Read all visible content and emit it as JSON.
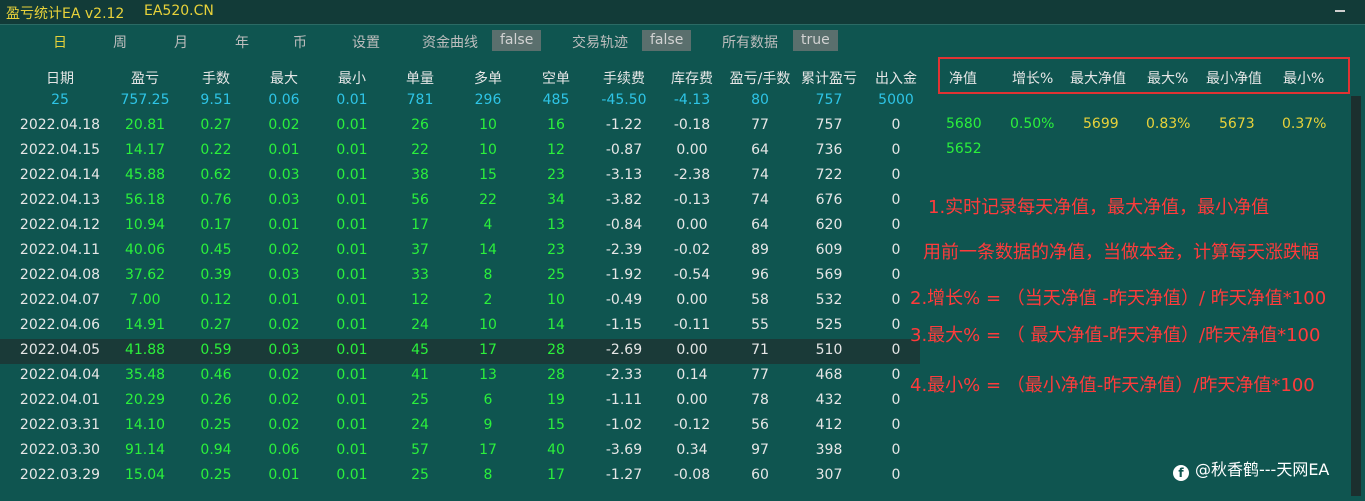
{
  "window": {
    "title": "盈亏统计EA v2.12",
    "site": "EA520.CN"
  },
  "tabs": [
    "日",
    "周",
    "月",
    "年",
    "币",
    "设置"
  ],
  "options": [
    {
      "label": "资金曲线",
      "value": "false"
    },
    {
      "label": "交易轨迹",
      "value": "false"
    },
    {
      "label": "所有数据",
      "value": "true"
    }
  ],
  "table": {
    "headers": [
      "日期",
      "盈亏",
      "手数",
      "最大",
      "最小",
      "单量",
      "多单",
      "空单",
      "手续费",
      "库存费",
      "盈亏/手数",
      "累计盈亏",
      "出入金"
    ],
    "summary": [
      "25",
      "757.25",
      "9.51",
      "0.06",
      "0.01",
      "781",
      "296",
      "485",
      "-45.50",
      "-4.13",
      "80",
      "757",
      "5000"
    ],
    "rows": [
      [
        "2022.04.18",
        "20.81",
        "0.27",
        "0.02",
        "0.01",
        "26",
        "10",
        "16",
        "-1.22",
        "-0.18",
        "77",
        "757",
        "0"
      ],
      [
        "2022.04.15",
        "14.17",
        "0.22",
        "0.01",
        "0.01",
        "22",
        "10",
        "12",
        "-0.87",
        "0.00",
        "64",
        "736",
        "0"
      ],
      [
        "2022.04.14",
        "45.88",
        "0.62",
        "0.03",
        "0.01",
        "38",
        "15",
        "23",
        "-3.13",
        "-2.38",
        "74",
        "722",
        "0"
      ],
      [
        "2022.04.13",
        "56.18",
        "0.76",
        "0.03",
        "0.01",
        "56",
        "22",
        "34",
        "-3.82",
        "-0.13",
        "74",
        "676",
        "0"
      ],
      [
        "2022.04.12",
        "10.94",
        "0.17",
        "0.01",
        "0.01",
        "17",
        "4",
        "13",
        "-0.84",
        "0.00",
        "64",
        "620",
        "0"
      ],
      [
        "2022.04.11",
        "40.06",
        "0.45",
        "0.02",
        "0.01",
        "37",
        "14",
        "23",
        "-2.39",
        "-0.02",
        "89",
        "609",
        "0"
      ],
      [
        "2022.04.08",
        "37.62",
        "0.39",
        "0.03",
        "0.01",
        "33",
        "8",
        "25",
        "-1.92",
        "-0.54",
        "96",
        "569",
        "0"
      ],
      [
        "2022.04.07",
        "7.00",
        "0.12",
        "0.01",
        "0.01",
        "12",
        "2",
        "10",
        "-0.49",
        "0.00",
        "58",
        "532",
        "0"
      ],
      [
        "2022.04.06",
        "14.91",
        "0.27",
        "0.02",
        "0.01",
        "24",
        "10",
        "14",
        "-1.15",
        "-0.11",
        "55",
        "525",
        "0"
      ],
      [
        "2022.04.05",
        "41.88",
        "0.59",
        "0.03",
        "0.01",
        "45",
        "17",
        "28",
        "-2.69",
        "0.00",
        "71",
        "510",
        "0"
      ],
      [
        "2022.04.04",
        "35.48",
        "0.46",
        "0.02",
        "0.01",
        "41",
        "13",
        "28",
        "-2.33",
        "0.14",
        "77",
        "468",
        "0"
      ],
      [
        "2022.04.01",
        "20.29",
        "0.26",
        "0.02",
        "0.01",
        "25",
        "6",
        "19",
        "-1.11",
        "0.00",
        "78",
        "432",
        "0"
      ],
      [
        "2022.03.31",
        "14.10",
        "0.25",
        "0.02",
        "0.01",
        "24",
        "9",
        "15",
        "-1.02",
        "-0.12",
        "56",
        "412",
        "0"
      ],
      [
        "2022.03.30",
        "91.14",
        "0.94",
        "0.06",
        "0.01",
        "57",
        "17",
        "40",
        "-3.69",
        "0.34",
        "97",
        "398",
        "0"
      ],
      [
        "2022.03.29",
        "15.04",
        "0.25",
        "0.01",
        "0.01",
        "25",
        "8",
        "17",
        "-1.27",
        "-0.08",
        "60",
        "307",
        "0"
      ]
    ],
    "selected_row": "2022.04.05"
  },
  "equity": {
    "headers": [
      "净值",
      "增长%",
      "最大净值",
      "最大%",
      "最小净值",
      "最小%"
    ],
    "row1": [
      "5680",
      "0.50%",
      "5699",
      "0.83%",
      "5673",
      "0.37%"
    ],
    "row2": [
      "5652"
    ]
  },
  "notes": [
    "1.实时记录每天净值，最大净值，最小净值",
    "用前一条数据的净值，当做本金，计算每天涨跌幅",
    "2.增长% = （当天净值 -昨天净值）/ 昨天净值*100",
    "3.最大% = （ 最大净值-昨天净值）/昨天净值*100",
    "4.最小% = （最小净值-昨天净值）/昨天净值*100"
  ],
  "credit": "@秋香鹤---天网EA",
  "colors": {
    "accent": "#e8d23a",
    "positive": "#2bf03b",
    "summary": "#2ec4e6",
    "annotation": "#ff3b3b",
    "background": "#0f5550"
  }
}
